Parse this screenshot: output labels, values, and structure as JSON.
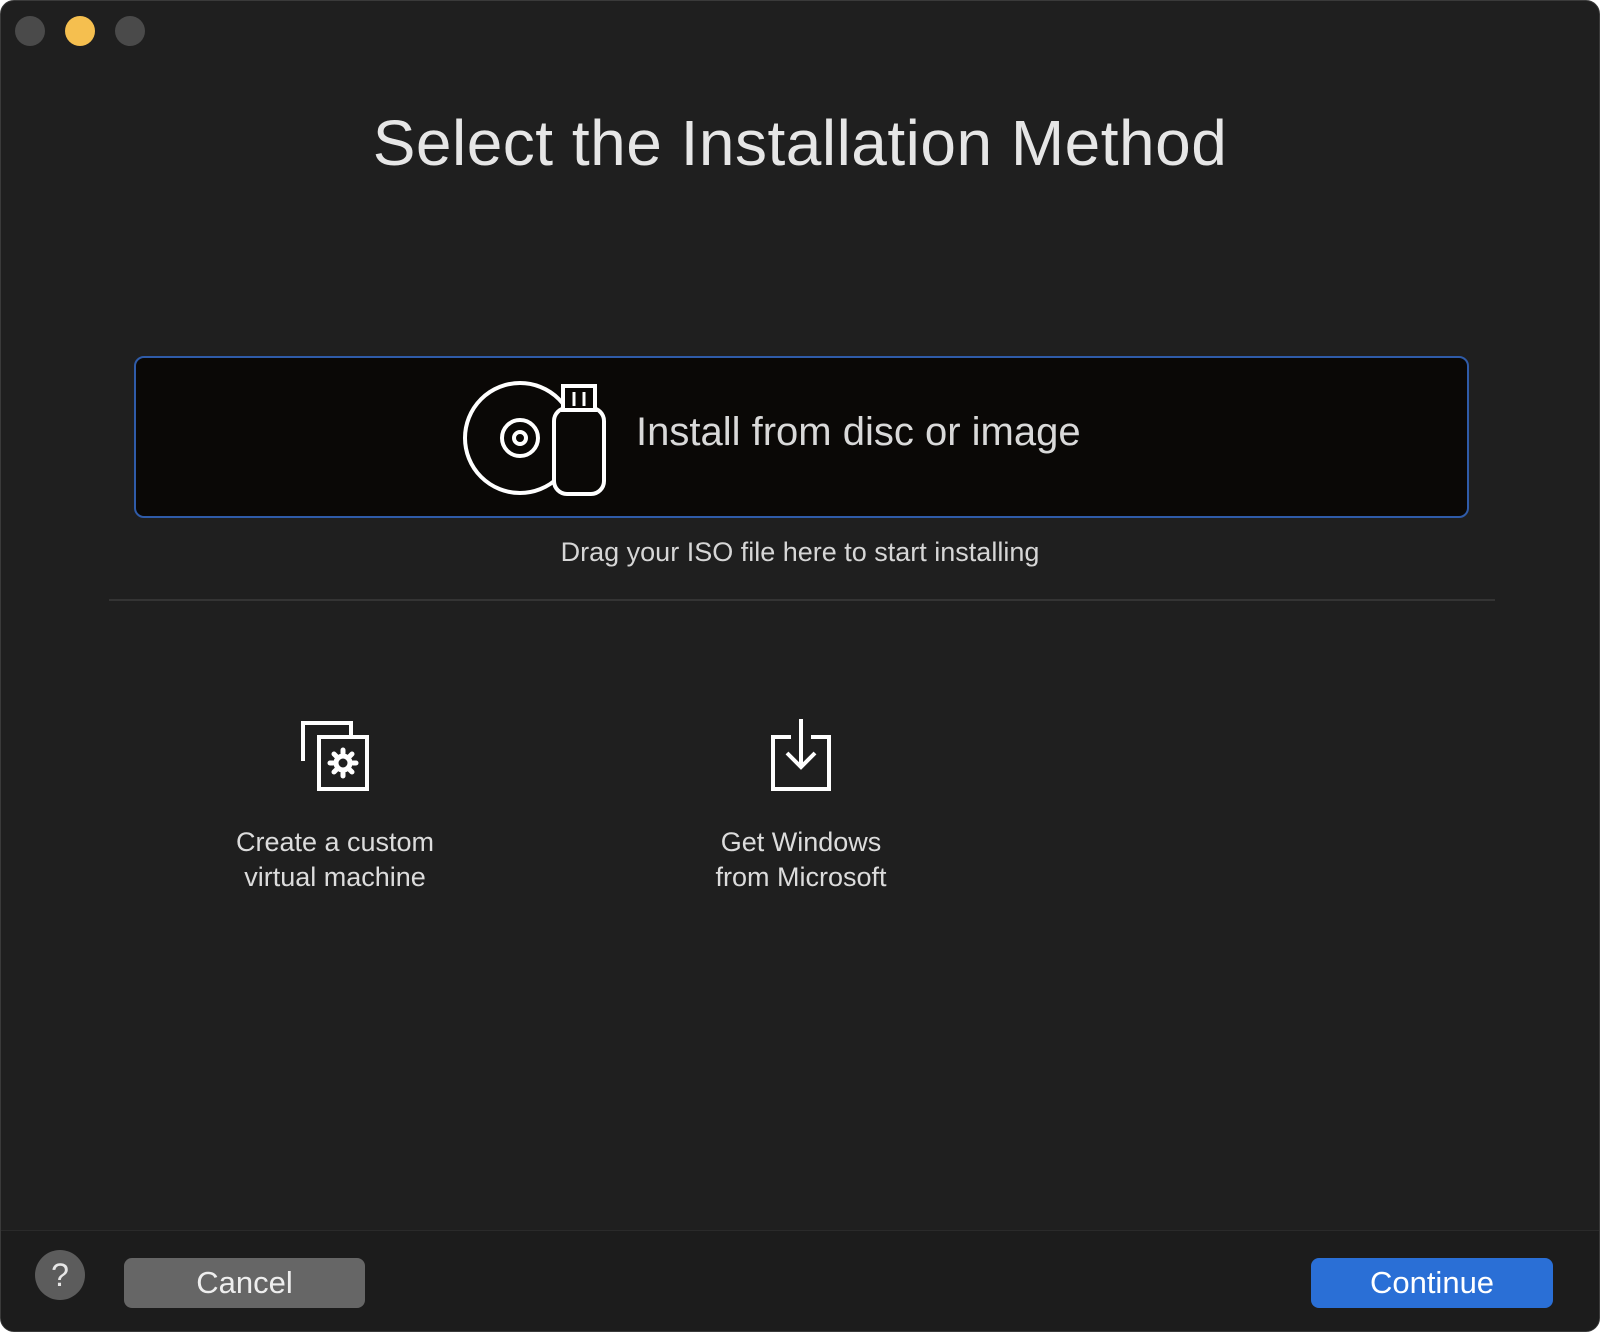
{
  "window": {
    "controls": [
      "close",
      "minimize",
      "zoom"
    ]
  },
  "header": {
    "title": "Select the Installation Method"
  },
  "primary_option": {
    "label": "Install from disc or image",
    "icon": "disc-usb-icon",
    "hint": "Drag your ISO file here to start installing"
  },
  "options": [
    {
      "label": "Create a custom\nvirtual machine",
      "icon": "custom-vm-icon"
    },
    {
      "label": "Get Windows\nfrom Microsoft",
      "icon": "download-icon"
    }
  ],
  "footer": {
    "help_label": "?",
    "cancel_label": "Cancel",
    "continue_label": "Continue"
  },
  "colors": {
    "background": "#1f1f1f",
    "selected_border": "#2f5ba8",
    "primary_button": "#2a6fd6",
    "minimize_control": "#f5bf4f"
  }
}
